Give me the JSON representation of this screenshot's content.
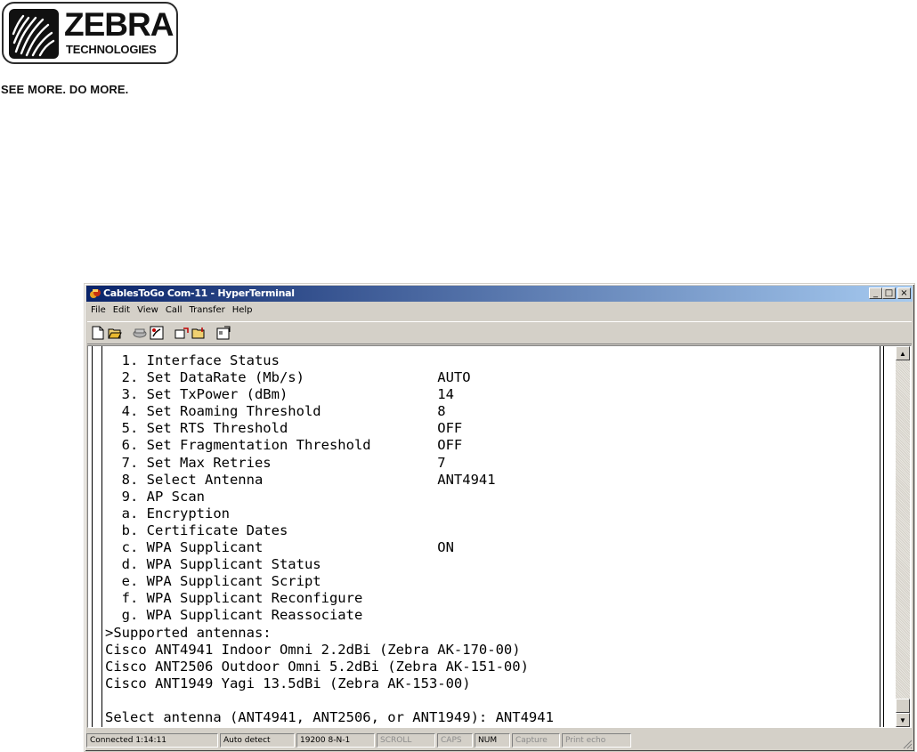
{
  "logo": {
    "wordmark": "ZEBRA",
    "subtitle": "TECHNOLOGIES",
    "tagline": "SEE MORE. DO MORE."
  },
  "window": {
    "title": "CablesToGo Com-11 - HyperTerminal",
    "controls": {
      "minimize": "_",
      "maximize": "□",
      "close": "×"
    }
  },
  "menu": [
    "File",
    "Edit",
    "View",
    "Call",
    "Transfer",
    "Help"
  ],
  "toolbar": [
    "new-icon",
    "open-icon",
    "disconnect-icon",
    "call-icon",
    "send-icon",
    "receive-icon",
    "properties-icon"
  ],
  "terminal": {
    "lines": [
      "  1. Interface Status",
      "  2. Set DataRate (Mb/s)                AUTO",
      "  3. Set TxPower (dBm)                  14",
      "  4. Set Roaming Threshold              8",
      "  5. Set RTS Threshold                  OFF",
      "  6. Set Fragmentation Threshold        OFF",
      "  7. Set Max Retries                    7",
      "  8. Select Antenna                     ANT4941",
      "  9. AP Scan",
      "  a. Encryption",
      "  b. Certificate Dates",
      "  c. WPA Supplicant                     ON",
      "  d. WPA Supplicant Status",
      "  e. WPA Supplicant Script",
      "  f. WPA Supplicant Reconfigure",
      "  g. WPA Supplicant Reassociate",
      ">Supported antennas:",
      "Cisco ANT4941 Indoor Omni 2.2dBi (Zebra AK-170-00)",
      "Cisco ANT2506 Outdoor Omni 5.2dBi (Zebra AK-151-00)",
      "Cisco ANT1949 Yagi 13.5dBi (Zebra AK-153-00)",
      "",
      "Select antenna (ANT4941, ANT2506, or ANT1949): ANT4941"
    ]
  },
  "status": {
    "connected": "Connected 1:14:11",
    "detect": "Auto detect",
    "settings": "19200 8-N-1",
    "scroll": "SCROLL",
    "caps": "CAPS",
    "num": "NUM",
    "capture": "Capture",
    "print_echo": "Print echo"
  },
  "colors": {
    "titlebar_start": "#0a246a",
    "titlebar_end": "#a6caf0",
    "window_face": "#d4d0c8"
  }
}
